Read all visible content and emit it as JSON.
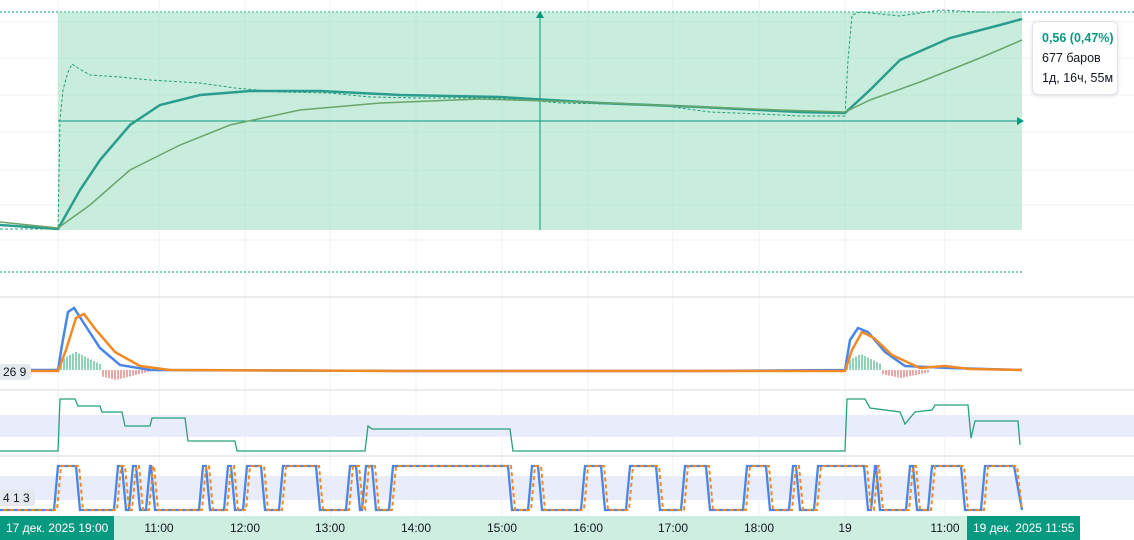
{
  "measure": {
    "change": "0,56 (0,47%)",
    "bars": "677 баров",
    "duration": "1д, 16ч, 55м"
  },
  "panes": {
    "oscillator_label": "26 9",
    "stochastic_label": "4 1 3"
  },
  "xaxis": {
    "start_badge": "17 дек. 2025 19:00",
    "end_badge": "19 дек. 2025 11:55",
    "ticks": [
      "11:00",
      "12:00",
      "13:00",
      "14:00",
      "15:00",
      "16:00",
      "17:00",
      "18:00",
      "19",
      "11:00"
    ]
  },
  "colors": {
    "range_fill": "#9adfc0",
    "accent": "#089981",
    "price_line": "#26a17b",
    "ema_fast": "#2a9d8f",
    "ema_slow": "#6aa56a",
    "macd_line": "#4a86e8",
    "signal_line": "#f08a24",
    "band": "#e8ecfb"
  },
  "icons": [
    "arrow-right-icon",
    "arrow-up-icon"
  ]
}
